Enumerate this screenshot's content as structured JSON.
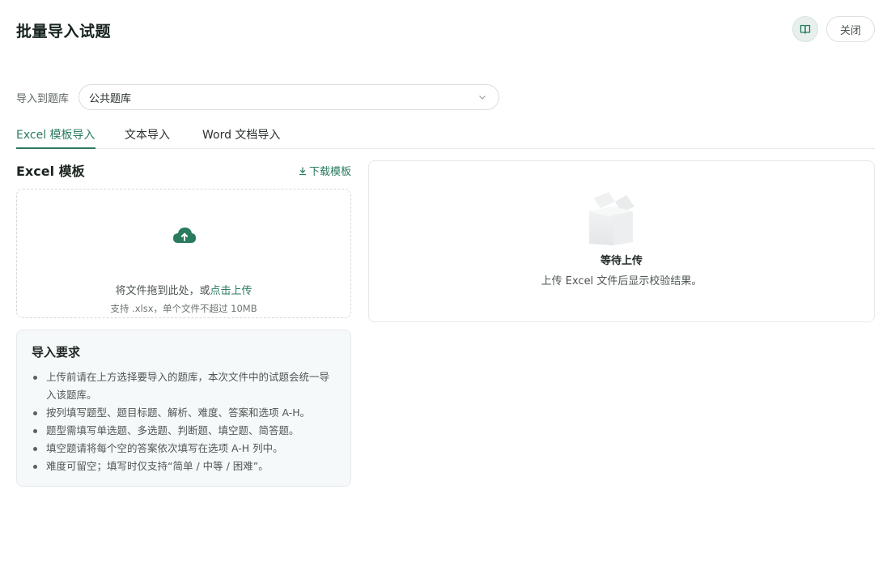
{
  "header": {
    "title": "批量导入试题",
    "close_label": "关闭",
    "book_icon": "book-open-icon"
  },
  "bank": {
    "label": "导入到题库",
    "selected": "公共题库"
  },
  "tabs": [
    {
      "label": "Excel 模板导入",
      "active": true
    },
    {
      "label": "文本导入",
      "active": false
    },
    {
      "label": "Word 文档导入",
      "active": false
    }
  ],
  "excel": {
    "title": "Excel 模板",
    "download_label": "下载模板"
  },
  "upload": {
    "main_prefix": "将文件拖到此处，或",
    "main_link": "点击上传",
    "hint": "支持 .xlsx，单个文件不超过 10MB"
  },
  "requirements": {
    "title": "导入要求",
    "items": [
      "上传前请在上方选择要导入的题库，本次文件中的试题会统一导入该题库。",
      "按列填写题型、题目标题、解析、难度、答案和选项 A-H。",
      "题型需填写单选题、多选题、判断题、填空题、简答题。",
      "填空题请将每个空的答案依次填写在选项 A-H 列中。",
      "难度可留空；填写时仅支持“简单 / 中等 / 困难”。"
    ]
  },
  "result": {
    "title": "等待上传",
    "desc": "上传 Excel 文件后显示校验结果。"
  },
  "colors": {
    "accent": "#2a7a5e",
    "border": "#e6e9eb",
    "req_bg": "#f6f9fa"
  }
}
